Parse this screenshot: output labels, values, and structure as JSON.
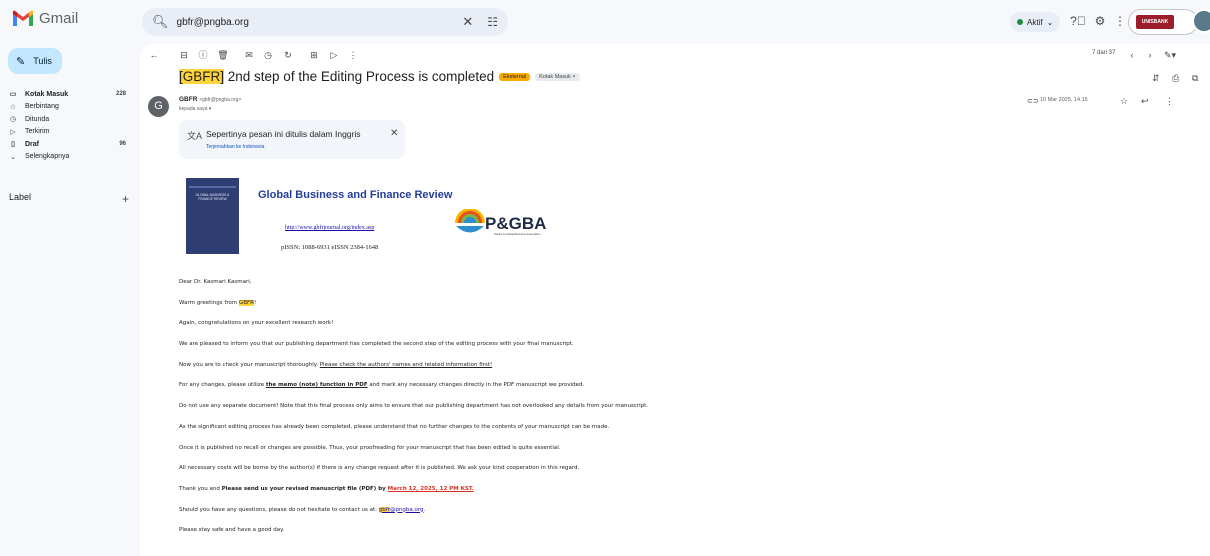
{
  "app": {
    "name": "Gmail"
  },
  "search": {
    "value": "gbfr@pngba.org"
  },
  "status": {
    "label": "Aktif"
  },
  "account": {
    "badge": "UNISBANK"
  },
  "sidebar": {
    "compose": "Tulis",
    "items": [
      {
        "label": "Kotak Masuk",
        "count": "228",
        "icon": "inbox-icon"
      },
      {
        "label": "Berbintang",
        "count": "",
        "icon": "star-icon"
      },
      {
        "label": "Ditunda",
        "count": "",
        "icon": "clock-icon"
      },
      {
        "label": "Terkirim",
        "count": "",
        "icon": "send-icon"
      },
      {
        "label": "Draf",
        "count": "96",
        "icon": "draft-icon"
      },
      {
        "label": "Selengkapnya",
        "count": "",
        "icon": "chevron-down-icon"
      }
    ],
    "label_header": "Label"
  },
  "toolbar": {
    "pager": "7 dari 37"
  },
  "email": {
    "subject_prefix": "[GBFR]",
    "subject_rest": " 2nd step of the Editing Process is completed",
    "tag_external": "Eksternal",
    "tag_inbox": "Kotak Masuk ×",
    "sender_name": "GBFR",
    "sender_email": "<gbfr@pngba.org>",
    "to": "kepada saya ▾",
    "date": "10 Mar 2025, 14.15",
    "avatar_letter": "G"
  },
  "translate": {
    "message": "Sepertinya pesan ini ditulis dalam Inggris",
    "action": "Terjemahkan ke Indonesia"
  },
  "journal": {
    "cover_text": "GLOBAL BUSINESS & FINANCE REVIEW",
    "title": "Global Business and Finance Review",
    "link": "http://www.gbfrjournal.org/index.asp",
    "issn": "pISSN: 1088-6931   eISSN 2384-1648",
    "logo_text": "P&GBA",
    "logo_sub": "Pacific & Global Business Association"
  },
  "body": {
    "greeting": "Dear Dr. Kasmari Kasmari,",
    "p1_a": "Warm greetings from ",
    "p1_hl": "GBFR",
    "p1_b": "!",
    "p2": "Again, congratulations on your excellent research work!",
    "p3": "We are pleased to inform you that our publishing department has completed the second step of the editing process with your final manuscript.",
    "p4_a": "Now you are to check your manuscript thoroughly. ",
    "p4_u": "Please check the authors' names and related information first!",
    "p5_a": "For any changes, please utilize ",
    "p5_b": "the memo (note) function in PDF",
    "p5_c": " and mark any necessary changes directly in the PDF manuscript we provided.",
    "p6": "Do not use any separate document! Note that this final process only aims to ensure that our publishing department has not overlooked any details from your manuscript.",
    "p7": "As the significant editing process has already been completed, please understand that no further changes to the contents of your manuscript can be made.",
    "p8": "Once it is published no recall or changes are possible. Thus, your proofreading for your manuscript that has been edited is quite essential.",
    "p9": "All necessary costs will be borne by the author(s) if there is any change request after it is published. We ask your kind cooperation in this regard.",
    "p10_a": "Thank you and ",
    "p10_b": "Please send us your revised manuscript file (PDF) by ",
    "p10_c": "March 12, 2025, 12 PM KST.",
    "p11_a": "Should you have any questions, please do not hesitate to contact us at: ",
    "p11_hl": "gbfr",
    "p11_b": "@pngba.org",
    "p11_c": ".",
    "p12": "Please stay safe and have a good day."
  },
  "colors": {
    "accent": "#0b57d0",
    "compose_bg": "#c2e7ff",
    "highlight": "#ffd43b",
    "external_tag": "#f9ab00",
    "deadline": "#d93025"
  }
}
